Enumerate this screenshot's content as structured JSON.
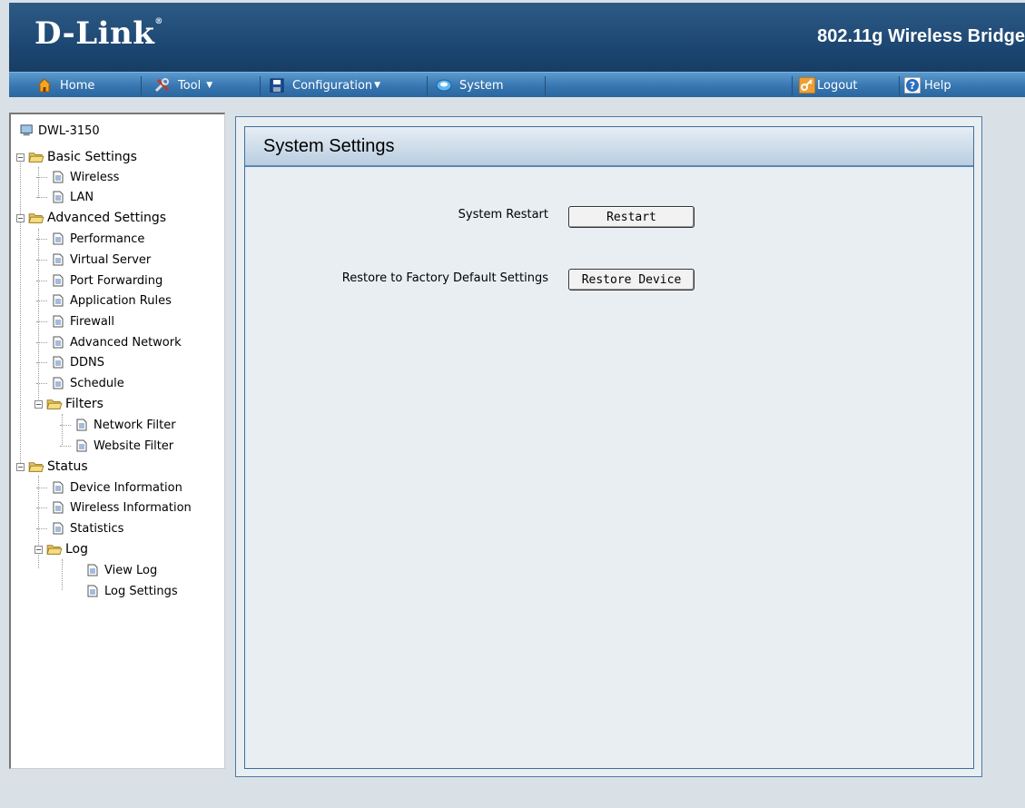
{
  "header": {
    "logo": "D-Link",
    "product": "802.11g Wireless Bridge"
  },
  "menu": {
    "home": "Home",
    "tool": "Tool",
    "configuration": "Configuration",
    "system": "System",
    "logout": "Logout",
    "help": "Help"
  },
  "tree": {
    "root": "DWL-3150",
    "basic": "Basic Settings",
    "basic_items": [
      "Wireless",
      "LAN"
    ],
    "advanced": "Advanced Settings",
    "advanced_items": [
      "Performance",
      "Virtual Server",
      "Port Forwarding",
      "Application Rules",
      "Firewall",
      "Advanced Network",
      "DDNS",
      "Schedule"
    ],
    "filters": "Filters",
    "filters_items": [
      "Network Filter",
      "Website Filter"
    ],
    "status": "Status",
    "status_items": [
      "Device Information",
      "Wireless Information",
      "Statistics"
    ],
    "log": "Log",
    "log_items": [
      "View Log",
      "Log Settings"
    ]
  },
  "main": {
    "title": "System Settings",
    "restart_label": "System Restart",
    "restart_button": "Restart",
    "restore_label": "Restore to Factory Default Settings",
    "restore_button": "Restore Device"
  },
  "colors": {
    "header_bg": "#1b4570",
    "menubar_bg": "#3776b0",
    "page_bg": "#d9e1e7",
    "panel_bg": "#e9eef2"
  }
}
